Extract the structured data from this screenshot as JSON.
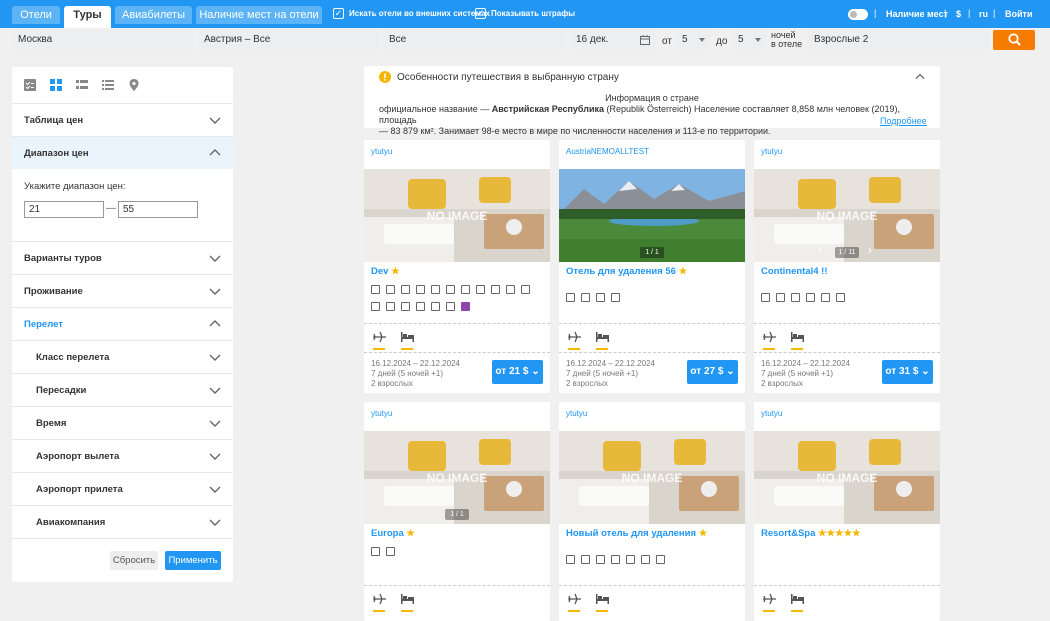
{
  "topbar": {
    "tabs": [
      "Отели",
      "Туры",
      "Авиабилеты",
      "Наличие мест на отели"
    ],
    "check_external": "Искать отели во внешних системах",
    "check_fines": "Показывать штрафы",
    "availability": "Наличие мест",
    "currency": "$",
    "lang": "ru",
    "login": "Войти"
  },
  "search": {
    "from": "Москва",
    "to": "Австрия – Все",
    "region": "Все",
    "date": "16 дек.",
    "nights_from_label": "от",
    "nights_from": "5",
    "nights_to_label": "до",
    "nights_to": "5",
    "nights_label_1": "ночей",
    "nights_label_2": "в отеле",
    "guests": "Взрослые 2"
  },
  "filters": {
    "price_table": "Таблица цен",
    "price_range": "Диапазон цен",
    "range_hint": "Укажите диапазон цен:",
    "range_from": "21",
    "range_dash": "—",
    "range_to": "55",
    "tour_variants": "Варианты туров",
    "accommodation": "Проживание",
    "flight": "Перелет",
    "flight_class": "Класс перелета",
    "transfers": "Пересадки",
    "time": "Время",
    "dep_airport": "Аэропорт вылета",
    "arr_airport": "Аэропорт прилета",
    "airline": "Авиакомпания",
    "reset": "Сбросить",
    "apply": "Применить"
  },
  "info": {
    "title": "Особенности путешествия в выбранную страну",
    "heading": "Информация о стране",
    "text_pre": "официальное название — ",
    "text_bold": "Австрийская Республика",
    "text_mid": " (Republik Österreich) Население составляет 8,858 млн человек (2019), площадь",
    "text_line2": "— 83 879 км². Занимает 98-е место в мире по численности населения и 113-е по территории.",
    "more": "Подробнее"
  },
  "cards": [
    {
      "operator": "ytutyu",
      "name": "Dev",
      "stars": "★",
      "no_image": "NO IMAGE",
      "slide": "",
      "dates": "16.12.2024 – 22.12.2024",
      "nights": "7 дней (5 ночей +1)",
      "guests": "2 взрослых",
      "price": "от 21 $"
    },
    {
      "operator": "AustriaNEMOALLTEST",
      "name": "Отель для удаления 56",
      "stars": "★",
      "no_image": "",
      "slide": "1 / 1",
      "dates": "16.12.2024 – 22.12.2024",
      "nights": "7 дней (5 ночей +1)",
      "guests": "2 взрослых",
      "price": "от 27 $"
    },
    {
      "operator": "ytutyu",
      "name": "Continental4 !!",
      "stars": "",
      "no_image": "NO IMAGE",
      "slide": "1 / 11",
      "dates": "16.12.2024 – 22.12.2024",
      "nights": "7 дней (5 ночей +1)",
      "guests": "2 взрослых",
      "price": "от 31 $"
    },
    {
      "operator": "ytutyu",
      "name": "Europa",
      "stars": "★",
      "no_image": "NO IMAGE",
      "slide": "1 / 1"
    },
    {
      "operator": "ytutyu",
      "name": "Новый отель для удаления",
      "stars": "★",
      "no_image": "NO IMAGE",
      "slide": ""
    },
    {
      "operator": "ytutyu",
      "name": "Resort&Spa",
      "stars": "★★★★★",
      "no_image": "NO IMAGE",
      "slide": ""
    }
  ],
  "colors": {
    "primary": "#2196f3",
    "accent": "#f57c00",
    "star": "#f5b800"
  }
}
